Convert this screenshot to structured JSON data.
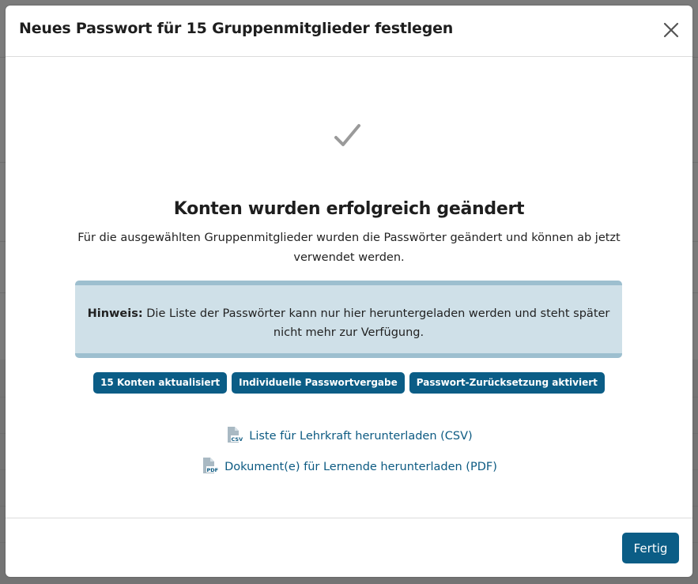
{
  "dialog": {
    "title": "Neues Passwort für 15 Gruppenmitglieder festlegen",
    "close_icon": "close-icon"
  },
  "success": {
    "icon": "checkmark-icon",
    "heading": "Konten wurden erfolgreich geändert",
    "text": "Für die ausgewählten Gruppenmitglieder wurden die Passwörter geändert und können ab jetzt verwendet werden."
  },
  "notice": {
    "label": "Hinweis:",
    "text": "Die Liste der Passwörter kann nur hier heruntergeladen werden und steht später nicht mehr zur Verfügung."
  },
  "badges": [
    "15 Konten aktualisiert",
    "Individuelle Passwortvergabe",
    "Passwort-Zurücksetzung aktiviert"
  ],
  "downloads": {
    "csv": {
      "icon": "csv-file-icon",
      "label": "Liste für Lehrkraft herunterladen (CSV)"
    },
    "pdf": {
      "icon": "pdf-file-icon",
      "label": "Dokument(e) für Lernende herunterladen (PDF)"
    }
  },
  "footer": {
    "done_label": "Fertig"
  },
  "colors": {
    "primary": "#0b5d86",
    "link": "#0c5a82",
    "notice_bg": "#cfe0e8",
    "notice_border": "#9dbfcf",
    "check": "#9a9a9a"
  }
}
